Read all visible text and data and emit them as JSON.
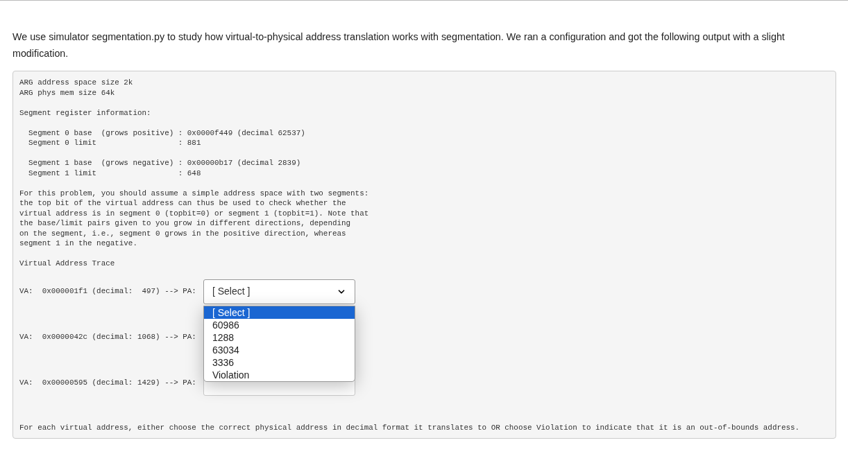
{
  "intro": "We use simulator segmentation.py to study how virtual-to-physical address translation works with segmentation. We ran a configuration and got the following output with a slight modification.",
  "code_blocks": [
    [
      "ARG address space size 2k",
      "ARG phys mem size 64k"
    ],
    [
      "Segment register information:"
    ],
    [
      "  Segment 0 base  (grows positive) : 0x0000f449 (decimal 62537)",
      "  Segment 0 limit                  : 881"
    ],
    [
      "  Segment 1 base  (grows negative) : 0x00000b17 (decimal 2839)",
      "  Segment 1 limit                  : 648"
    ],
    [
      "For this problem, you should assume a simple address space with two segments:",
      "the top bit of the virtual address can thus be used to check whether the",
      "virtual address is in segment 0 (topbit=0) or segment 1 (topbit=1). Note that",
      "the base/limit pairs given to you grow in different directions, depending",
      "on the segment, i.e., segment 0 grows in the positive direction, whereas",
      "segment 1 in the negative."
    ],
    [
      "Virtual Address Trace"
    ]
  ],
  "traces": [
    {
      "text": "VA:  0x000001f1 (decimal:  497) --> PA:",
      "select": {
        "value": "[ Select ]",
        "open": true,
        "options": [
          {
            "label": "[ Select ]",
            "selected": true
          },
          {
            "label": "60986",
            "selected": false
          },
          {
            "label": "1288",
            "selected": false
          },
          {
            "label": "63034",
            "selected": false
          },
          {
            "label": "3336",
            "selected": false
          },
          {
            "label": "Violation",
            "selected": false
          }
        ]
      }
    },
    {
      "text": "VA:  0x0000042c (decimal: 1068) --> PA:"
    },
    {
      "text": "VA:  0x00000595 (decimal: 1429) --> PA:",
      "select": {
        "open": false
      }
    }
  ],
  "footer": "For each virtual address, either choose the correct physical address in decimal format it translates to OR choose Violation to indicate that it is an out-of-bounds address."
}
